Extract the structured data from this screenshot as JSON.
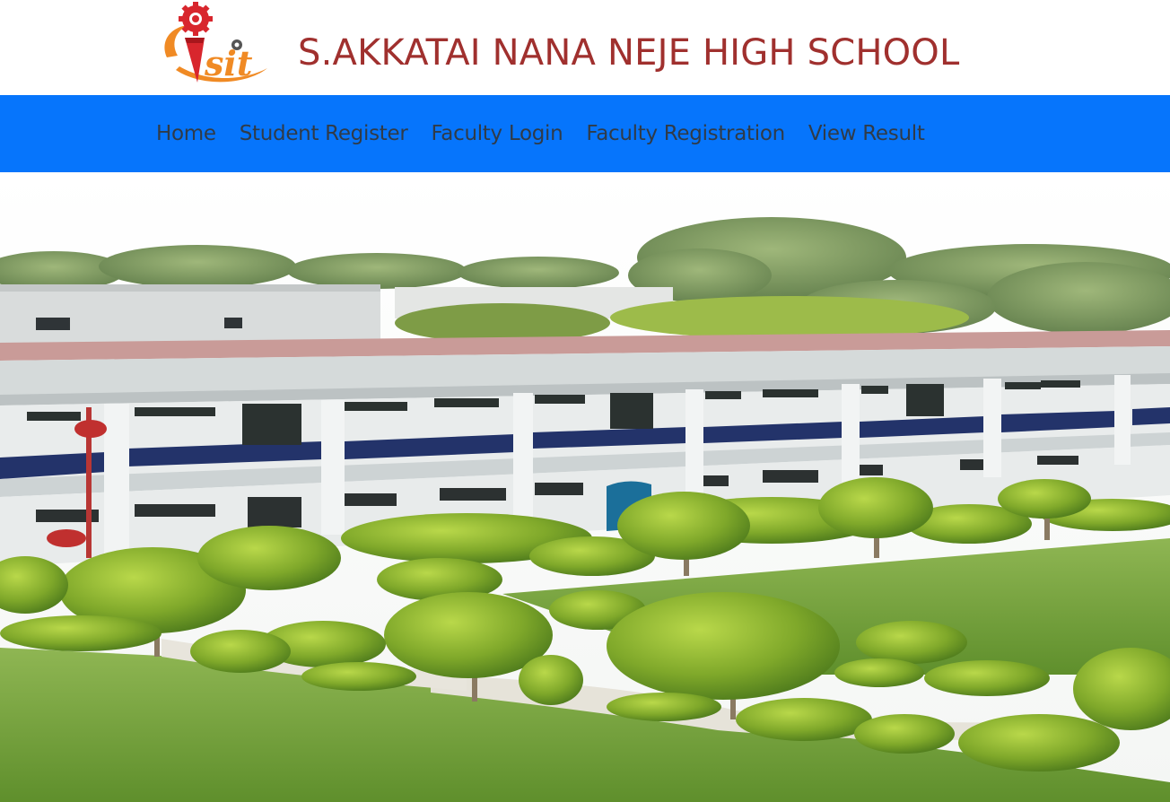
{
  "header": {
    "logo": {
      "text": "sit",
      "icon": "gear-pencil-logo-icon",
      "colors": {
        "red": "#c8222b",
        "orange": "#f08a24"
      }
    },
    "title": "S.AKKATAI NANA NEJE HIGH SCHOOL",
    "title_color": "#a0302e"
  },
  "nav": {
    "background": "#0675fc",
    "items": [
      {
        "label": "Home"
      },
      {
        "label": "Student Register"
      },
      {
        "label": "Faculty Login"
      },
      {
        "label": "Faculty Registration"
      },
      {
        "label": "View Result"
      }
    ]
  },
  "banner": {
    "image": "school-campus-photo",
    "description_icon": "campus-building-image"
  }
}
